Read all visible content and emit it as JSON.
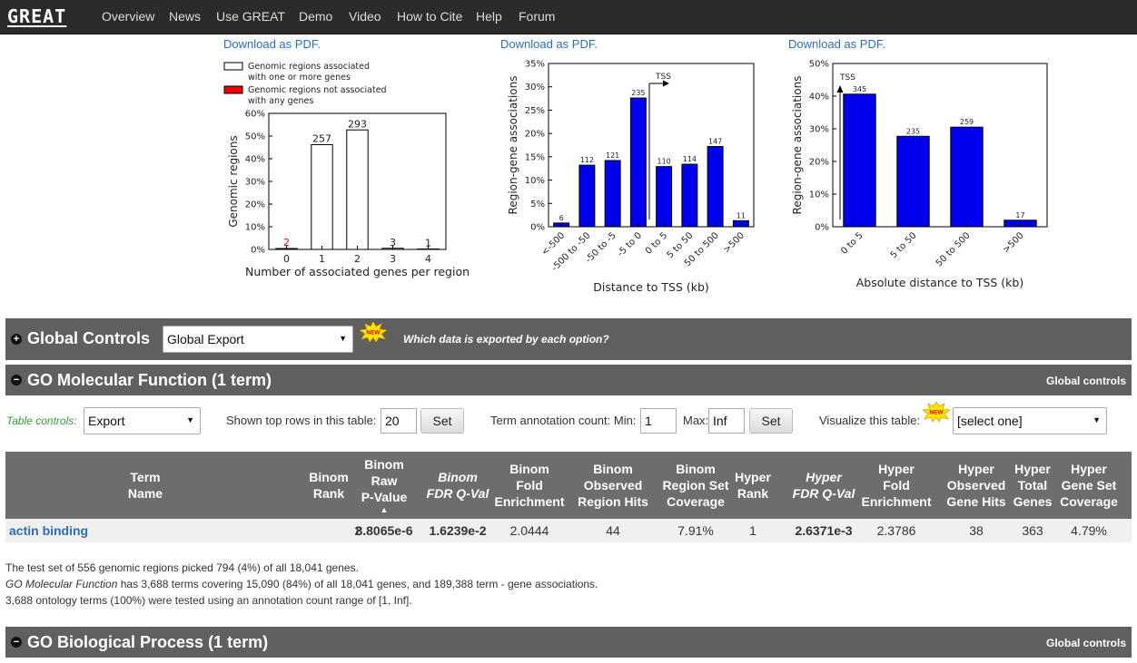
{
  "nav": {
    "logo": "GREAT",
    "items": [
      "Overview",
      "News",
      "Use GREAT",
      "Demo",
      "Video",
      "How to Cite",
      "Help",
      "Forum"
    ]
  },
  "download_label": "Download as PDF.",
  "chart_data": [
    {
      "type": "bar",
      "legend": [
        "Genomic regions associated with one or more genes",
        "Genomic regions not associated with any genes"
      ],
      "legend_line1": [
        "Genomic regions associated",
        "Genomic regions not associated"
      ],
      "legend_line2": [
        "with one or more genes",
        "with any genes"
      ],
      "categories": [
        "0",
        "1",
        "2",
        "3",
        "4"
      ],
      "values": [
        0.4,
        46.2,
        52.7,
        0.5,
        0.2
      ],
      "data_labels": [
        "2",
        "257",
        "293",
        "3",
        "1"
      ],
      "colors": [
        "#ffffff",
        "#ffffff",
        "#ffffff",
        "#ffffff",
        "#ffffff"
      ],
      "label_colors": [
        "#e00",
        "#222",
        "#222",
        "#222",
        "#222"
      ],
      "ylabel": "Genomic regions",
      "xlabel": "Number of associated genes per region",
      "ylim": [
        0,
        60
      ],
      "yticks": [
        "0%",
        "10%",
        "20%",
        "30%",
        "40%",
        "50%",
        "60%"
      ]
    },
    {
      "type": "bar",
      "categories": [
        "<-500",
        "-500 to -50",
        "-50 to -5",
        "-5 to 0",
        "0 to 5",
        "5 to 50",
        "50 to 500",
        ">500"
      ],
      "values": [
        0.8,
        13.2,
        14.2,
        27.6,
        12.9,
        13.4,
        17.2,
        1.3
      ],
      "data_labels": [
        "6",
        "112",
        "121",
        "235",
        "110",
        "114",
        "147",
        "11"
      ],
      "ylabel": "Region-gene associations",
      "xlabel": "Distance to TSS (kb)",
      "ylim": [
        0,
        35
      ],
      "yticks": [
        "0%",
        "5%",
        "10%",
        "15%",
        "20%",
        "25%",
        "30%",
        "35%"
      ],
      "annotation": "TSS",
      "color": "#0000ee"
    },
    {
      "type": "bar",
      "categories": [
        "0 to 5",
        "5 to 50",
        "50 to 500",
        ">500"
      ],
      "values": [
        40.6,
        27.7,
        30.5,
        2.0
      ],
      "data_labels": [
        "345",
        "235",
        "259",
        "17"
      ],
      "ylabel": "Region-gene associations",
      "xlabel": "Absolute distance to TSS (kb)",
      "ylim": [
        0,
        50
      ],
      "yticks": [
        "0%",
        "10%",
        "20%",
        "30%",
        "40%",
        "50%"
      ],
      "annotation": "TSS",
      "color": "#0000ee"
    }
  ],
  "global_controls": {
    "title": "Global Controls",
    "select_value": "Global Export",
    "help_link": "Which data is exported by each option?",
    "new_badge": "NEW"
  },
  "go_mf": {
    "title": "GO Molecular Function (1 term)",
    "right_link": "Global controls"
  },
  "table_controls": {
    "label": "Table controls:",
    "export_value": "Export",
    "top_rows_label": "Shown top rows in this table:",
    "top_rows_value": "20",
    "set_label": "Set",
    "annot_label": "Term annotation count: Min:",
    "min_value": "1",
    "max_label": "Max:",
    "max_value": "Inf",
    "visualize_label": "Visualize this table:",
    "visualize_value": "[select one]"
  },
  "table": {
    "headers": [
      "Term\nName",
      "Binom\nRank",
      "Binom\nRaw\nP-Value",
      "Binom\nFDR Q-Val",
      "Binom\nFold\nEnrichment",
      "Binom\nObserved\nRegion Hits",
      "Binom\nRegion Set\nCoverage",
      "Hyper\nRank",
      "Hyper\nFDR Q-Val",
      "Hyper\nFold\nEnrichment",
      "Hyper\nObserved\nGene Hits",
      "Hyper\nTotal\nGenes",
      "Hyper\nGene Set\nCoverage"
    ],
    "sort_indicator": "▲",
    "rows": [
      [
        "actin binding",
        "2",
        "8.8065e-6",
        "1.6239e-2",
        "2.0444",
        "44",
        "7.91%",
        "1",
        "2.6371e-3",
        "2.3786",
        "38",
        "363",
        "4.79%"
      ]
    ]
  },
  "summary": {
    "line1": "The test set of 556 genomic regions picked 794 (4%) of all 18,041 genes.",
    "line2_italic": "GO Molecular Function",
    "line2_rest": " has 3,688 terms covering 15,090 (84%) of all 18,041 genes, and 189,388 term - gene associations.",
    "line3": "3,688 ontology terms (100%) were tested using an annotation count range of [1, Inf]."
  },
  "go_bp": {
    "title": "GO Biological Process (1 term)",
    "right_link": "Global controls"
  }
}
